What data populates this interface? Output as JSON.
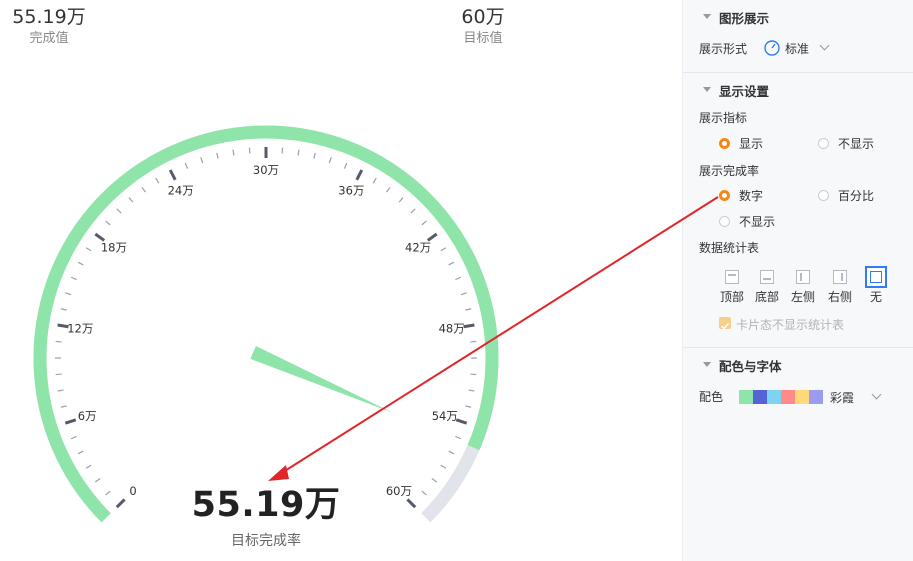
{
  "kpis": {
    "done_value": "55.19万",
    "done_label": "完成值",
    "target_value": "60万",
    "target_label": "目标值"
  },
  "gauge": {
    "current": 55.19,
    "max": 60,
    "unit": "万",
    "big_value": "55.19万",
    "caption": "目标完成率",
    "tick_labels": [
      "0",
      "6万",
      "12万",
      "18万",
      "24万",
      "30万",
      "36万",
      "42万",
      "48万",
      "54万",
      "60万"
    ],
    "colors": {
      "progress": "#8fe4a9",
      "track": "#e1e4ea",
      "tick": "#555b6b",
      "pointer": "#8fe4a9"
    }
  },
  "panel": {
    "section1": {
      "title": "图形展示"
    },
    "shape_label": "展示形式",
    "shape_value": "标准",
    "section2": {
      "title": "显示设置"
    },
    "indicator_label": "展示指标",
    "indicator_options": [
      {
        "label": "显示",
        "selected": true
      },
      {
        "label": "不显示",
        "selected": false
      }
    ],
    "rate_label": "展示完成率",
    "rate_options": [
      {
        "label": "数字",
        "selected": true
      },
      {
        "label": "百分比",
        "selected": false
      },
      {
        "label": "不显示",
        "selected": false
      }
    ],
    "table_label": "数据统计表",
    "table_positions": [
      {
        "label": "顶部",
        "icon": "layout-top-icon",
        "selected": false
      },
      {
        "label": "底部",
        "icon": "layout-bottom-icon",
        "selected": false
      },
      {
        "label": "左侧",
        "icon": "layout-left-icon",
        "selected": false
      },
      {
        "label": "右侧",
        "icon": "layout-right-icon",
        "selected": false
      },
      {
        "label": "无",
        "icon": "layout-none-icon",
        "selected": true
      }
    ],
    "card_option": {
      "label": "卡片态不显示统计表",
      "checked": true
    },
    "section3": {
      "title": "配色与字体"
    },
    "color_label": "配色",
    "palette_name": "彩霞",
    "palette": [
      "#8fe4a9",
      "#5563d6",
      "#7fd3f2",
      "#ff8a8a",
      "#ffd97a",
      "#9b9cf0"
    ],
    "accent": "#f28a15",
    "selected_blue": "#2f7cf6"
  },
  "annotation": {
    "arrow_color": "#e0262a",
    "from": "数字 radio",
    "to": "55.19万 big value"
  }
}
